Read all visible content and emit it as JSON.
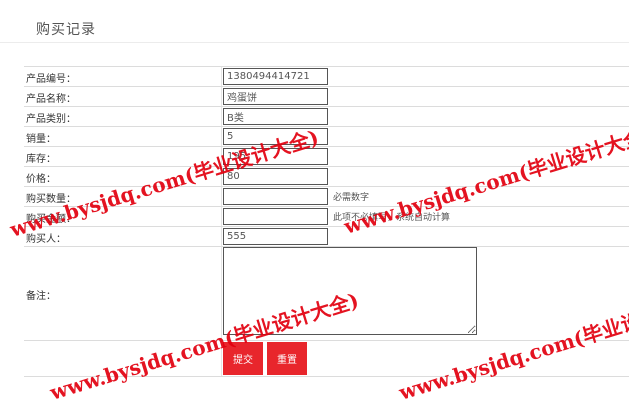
{
  "page_title": "购买记录",
  "form": {
    "rows": [
      {
        "label": "产品编号：",
        "value": "1380494414721"
      },
      {
        "label": "产品名称：",
        "value": "鸡蛋饼"
      },
      {
        "label": "产品类别：",
        "value": "B类"
      },
      {
        "label": "销量：",
        "value": "5"
      },
      {
        "label": "库存：",
        "value": "195"
      },
      {
        "label": "价格：",
        "value": "80"
      },
      {
        "label": "购买数量：",
        "value": "",
        "hint": "必需数字"
      },
      {
        "label": "购买金额：",
        "value": "",
        "hint": "此项不必填写，系统自动计算"
      },
      {
        "label": "购买人：",
        "value": "555"
      }
    ],
    "remark_label": "备注：",
    "remark_value": "",
    "submit_label": "提交",
    "reset_label": "重置"
  },
  "watermark": {
    "text": "www.bysjdq.com(毕业设计大全)",
    "color": "#e2000f"
  },
  "colors": {
    "button_bg": "#e8262c",
    "border": "#555555",
    "row_divider": "#dcdcdc"
  }
}
